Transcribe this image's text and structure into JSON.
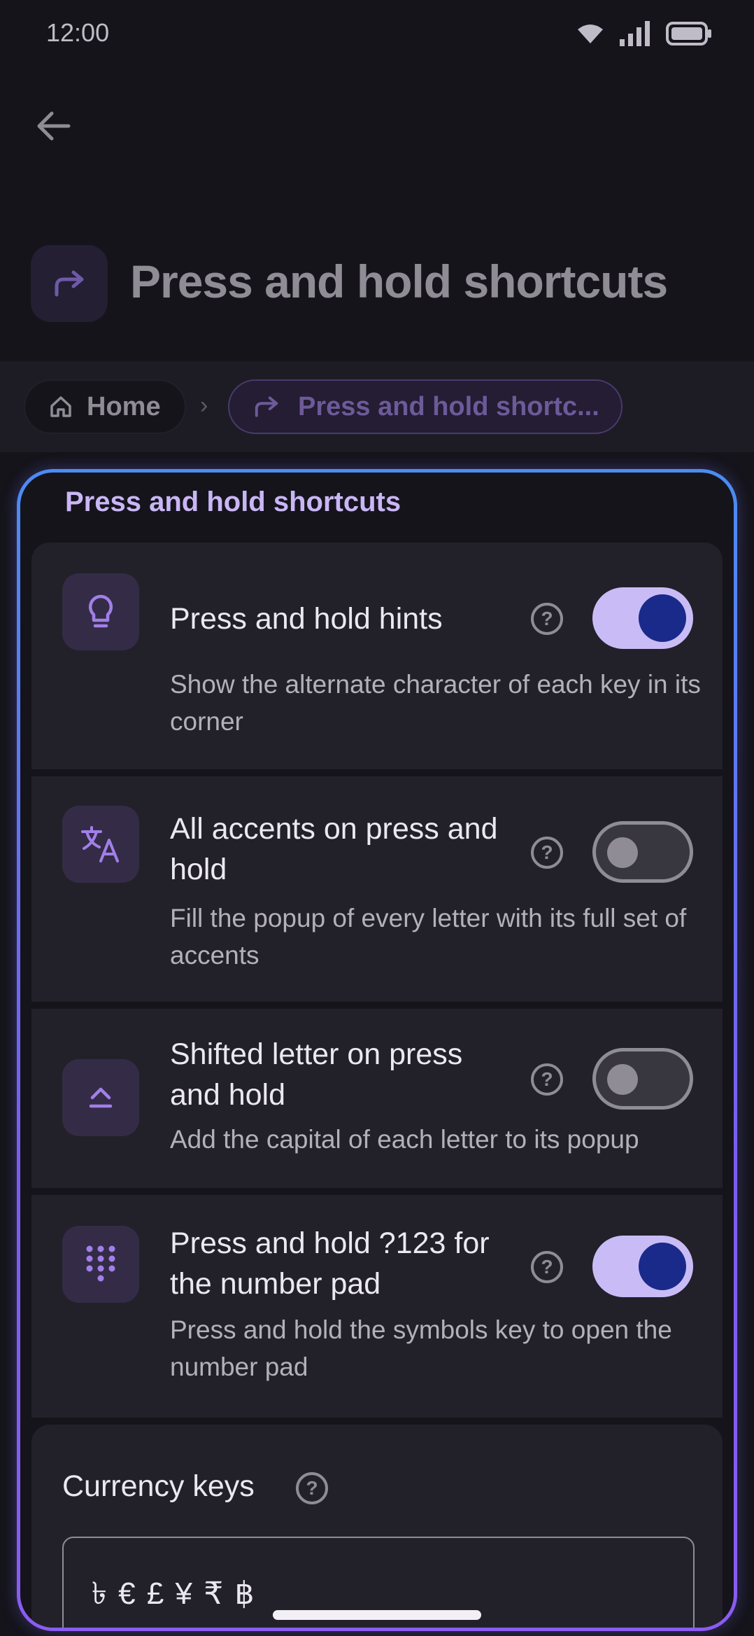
{
  "status_bar": {
    "time": "12:00"
  },
  "header": {
    "title": "Press and hold shortcuts"
  },
  "breadcrumb": {
    "home_label": "Home",
    "current_label": "Press and hold shortc..."
  },
  "section": {
    "title": "Press and hold shortcuts"
  },
  "settings": [
    {
      "title": "Press and hold hints",
      "description": "Show the alternate character of each key in its corner",
      "enabled": true,
      "icon": "lightbulb-icon"
    },
    {
      "title": "All accents on press and hold",
      "description": "Fill the popup of every letter with its full set of accents",
      "enabled": false,
      "icon": "translate-icon"
    },
    {
      "title": "Shifted letter on press and hold",
      "description": "Add the capital of each letter to its popup",
      "enabled": false,
      "icon": "shift-icon"
    },
    {
      "title": "Press and hold ?123 for the number pad",
      "description": "Press and hold the symbols key to open the number pad",
      "enabled": true,
      "icon": "dialpad-icon"
    }
  ],
  "currency": {
    "label": "Currency keys",
    "value": "৳ € £ ¥ ₹ ฿"
  },
  "colors": {
    "accent": "#c9bcf6",
    "toggle_knob_on": "#1a2a8a",
    "frame_top": "#4a8cf2",
    "frame_bottom": "#8a5cf2"
  }
}
